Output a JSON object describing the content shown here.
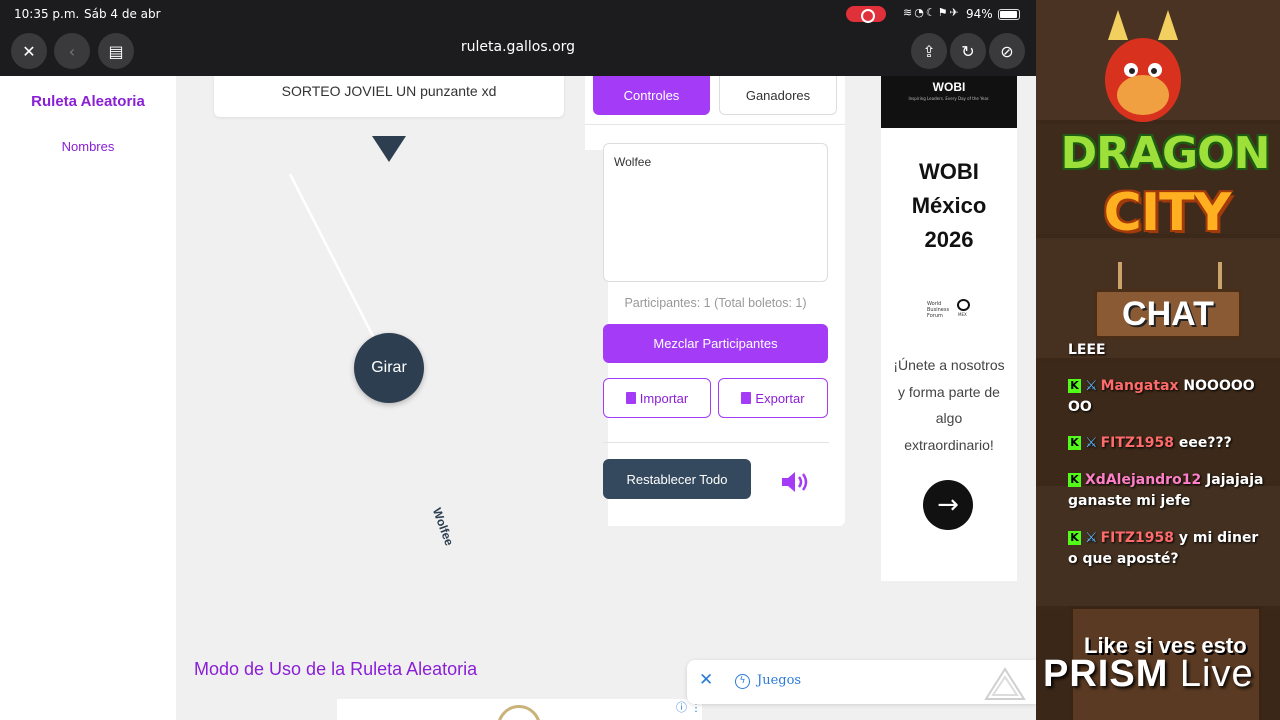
{
  "status_bar": {
    "time": "10:35 p.m.",
    "date": "Sáb 4 de abr",
    "battery": "94%"
  },
  "browser": {
    "url": "ruleta.gallos.org"
  },
  "sidebar": {
    "brand": "Ruleta Aleatoria",
    "nav_item": "Nombres"
  },
  "wheel": {
    "title": "SORTEO JOVIEL UN punzante xd",
    "spin_label": "Girar",
    "entry": "Wolfee"
  },
  "controls": {
    "tabs": [
      {
        "label": "Controles",
        "active": true
      },
      {
        "label": "Ganadores",
        "active": false
      }
    ],
    "names_text": "Wolfee",
    "participants_text": "Participantes: 1 (Total boletos: 1)",
    "shuffle_label": "Mezclar Participantes",
    "import_label": "Importar",
    "export_label": "Exportar",
    "reset_label": "Restablecer Todo",
    "accent_color": "#a43cf7",
    "dark_color": "#2c3e50"
  },
  "ad": {
    "brand": "WOBI",
    "tagline": "Inspiring Leaders. Every Day of the Year.",
    "title_lines": [
      "WOBI",
      "México",
      "2026"
    ],
    "org_lines": [
      "World",
      "Business",
      "Forum"
    ],
    "org_suffix": "MEX",
    "copy_lines": [
      "¡Únete a nosotros",
      "y forma parte de",
      "algo",
      "extraordinario!"
    ]
  },
  "page": {
    "howto_title": "Modo de Uso de la Ruleta Aleatoria"
  },
  "game_bar": {
    "label": "Juegos"
  },
  "overlay": {
    "logo_top": "DRAGON",
    "logo_bottom": "CITY",
    "chat_header": "CHAT",
    "messages": [
      {
        "user": "",
        "text": "LEEE"
      },
      {
        "user": "Mangatax",
        "text": "NOOOOO OO"
      },
      {
        "user": "FITZ1958",
        "text": "eee???"
      },
      {
        "user": "XdAlejandro12",
        "text": "Jajajaja ganaste mi jefe"
      },
      {
        "user": "FITZ1958",
        "text": "y mi diner o que aposté?"
      }
    ],
    "like_text": "Like si ves esto",
    "prism_bold": "PRISM",
    "prism_light": "Live"
  }
}
